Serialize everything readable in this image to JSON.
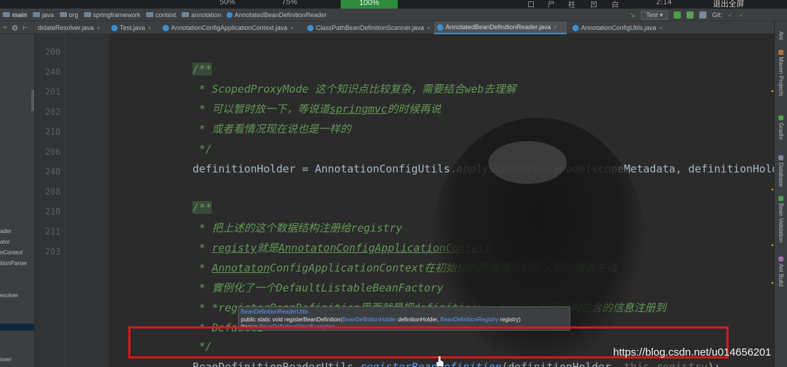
{
  "top_strip": {
    "zoom_50": "50%",
    "zoom_75": "75%",
    "zoom_100": "100%",
    "exit_fullscreen": "退出全屏",
    "glyphs": [
      "口",
      "尸",
      "柱",
      "凹",
      "白",
      "2:14"
    ]
  },
  "nav": {
    "crumbs": [
      "main",
      "java",
      "org",
      "springframework",
      "context",
      "annotation",
      "AnnotatedBeanDefinitionReader"
    ],
    "run_config": "Test",
    "git_label": "Git:"
  },
  "tabs": [
    {
      "label": "didateResolver.java"
    },
    {
      "label": "Test.java"
    },
    {
      "label": "AnnotationConfigApplicationContext.java"
    },
    {
      "label": "ClassPathBeanDefinitionScanner.java"
    },
    {
      "label": "AnnotatedBeanDefinitionReader.java",
      "active": true
    },
    {
      "label": "AnnotationConfigUtils.java"
    }
  ],
  "sidebar": {
    "items": [
      "ader",
      "ator",
      "nContext",
      "itionParser",
      "esolver",
      "nner"
    ]
  },
  "gutter": {
    "line_numbers": [
      "200",
      "240",
      "201",
      "202",
      "210",
      "206",
      "240",
      "208",
      "210",
      "211",
      "203"
    ]
  },
  "code": {
    "doc_open": "/**",
    "doc1_l1": " * ScopedProxyMode 这个知识点比较复杂，需要结合web去理解",
    "doc1_l2_a": " * 可以暂时放一下，等说道",
    "doc1_l2_b": "springmvc",
    "doc1_l2_c": "的时候再说",
    "doc1_l3": " * 或者看情况现在说也是一样的",
    "doc1_close": " */",
    "stmt1_a": "definitionHolder = AnnotationConfigUtils.",
    "stmt1_b": "applyScopedProxyMode",
    "stmt1_c": "(scopeMetadata, definitionHolder",
    "doc2_l1": " * 把上述的这个数据结构注册给registry",
    "doc2_l2_a": " * ",
    "doc2_l2_b": "registy",
    "doc2_l2_c": "就是",
    "doc2_l2_d": "AnnotatonConfigApplicationContext",
    "doc2_l3_a": " * ",
    "doc2_l3_b": "Annotaton",
    "doc2_l3_c": "ConfigApplicationContext在初始化的時候通過調用父類的構造方法",
    "doc2_l4": " * 實例化了一个DefaultListableBeanFactory",
    "doc2_l5": " * *registerBeanDefinition里面就是把definitionHolder这个数据结构包含的信息注册到",
    "doc2_l6": " * DefaultL",
    "doc2_close": " */",
    "stmt2_a": "BeanDefinitionReaderUtils.",
    "stmt2_b": "registerBeanDefinition",
    "stmt2_c": "(definitionHolder, ",
    "stmt2_d": "this.registry",
    "stmt2_e": ");"
  },
  "tooltip": {
    "class_name": "BeanDefinitionReaderUtils",
    "sig_prefix": "public static void registerBeanDefinition(",
    "sig_type1": "BeanDefinitionHolder",
    "sig_mid": " definitionHolder, ",
    "sig_type2": "BeanDefinitionRegistry",
    "sig_suffix": " registry)",
    "throws_prefix": "throws ",
    "throws_type": "BeanDefinitionStoreException"
  },
  "watermark": "https://blog.csdn.net/u014656201",
  "right_tools": [
    "Ant",
    "Maven Projects",
    "Gradle",
    "Database",
    "Bean Validation",
    "Ant Build"
  ],
  "colors": {
    "highlight": "#e0151a",
    "doc_comment": "#629755",
    "link": "#589df6",
    "active_tab": "#4e5254"
  }
}
